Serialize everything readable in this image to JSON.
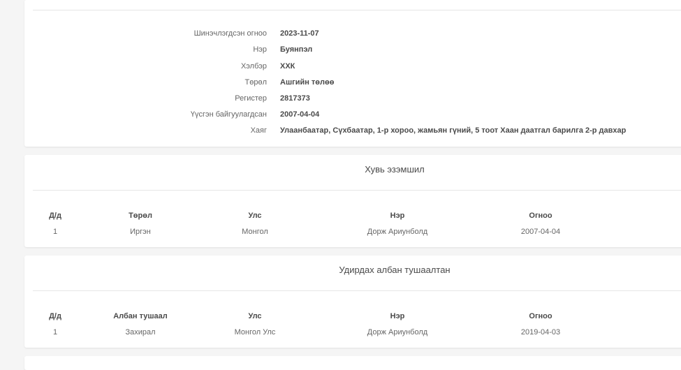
{
  "company": {
    "fields": [
      {
        "label": "Шинэчлэгдсэн огноо",
        "value": "2023-11-07"
      },
      {
        "label": "Нэр",
        "value": "Буянпэл"
      },
      {
        "label": "Хэлбэр",
        "value": "ХХК"
      },
      {
        "label": "Төрөл",
        "value": "Ашгийн төлөө"
      },
      {
        "label": "Регистер",
        "value": "2817373"
      },
      {
        "label": "Үүсгэн байгуулагдсан",
        "value": "2007-04-04"
      },
      {
        "label": "Хаяг",
        "value": "Улаанбаатар, Сүхбаатар, 1-р хороо, жамьян гүний, 5 тоот Хаан даатгал барилга 2-р давхар"
      }
    ]
  },
  "ownership": {
    "title": "Хувь эзэмшил",
    "headers": [
      "Д/д",
      "Төрөл",
      "Улс",
      "Нэр",
      "Огноо"
    ],
    "rows": [
      [
        "1",
        "Иргэн",
        "Монгол",
        "Дорж Ариунболд",
        "2007-04-04"
      ]
    ]
  },
  "officials": {
    "title": "Удирдах албан тушаалтан",
    "headers": [
      "Д/д",
      "Албан тушаал",
      "Улс",
      "Нэр",
      "Огноо"
    ],
    "rows": [
      [
        "1",
        "Захирал",
        "Монгол Улс",
        "Дорж Ариунболд",
        "2019-04-03"
      ]
    ]
  }
}
